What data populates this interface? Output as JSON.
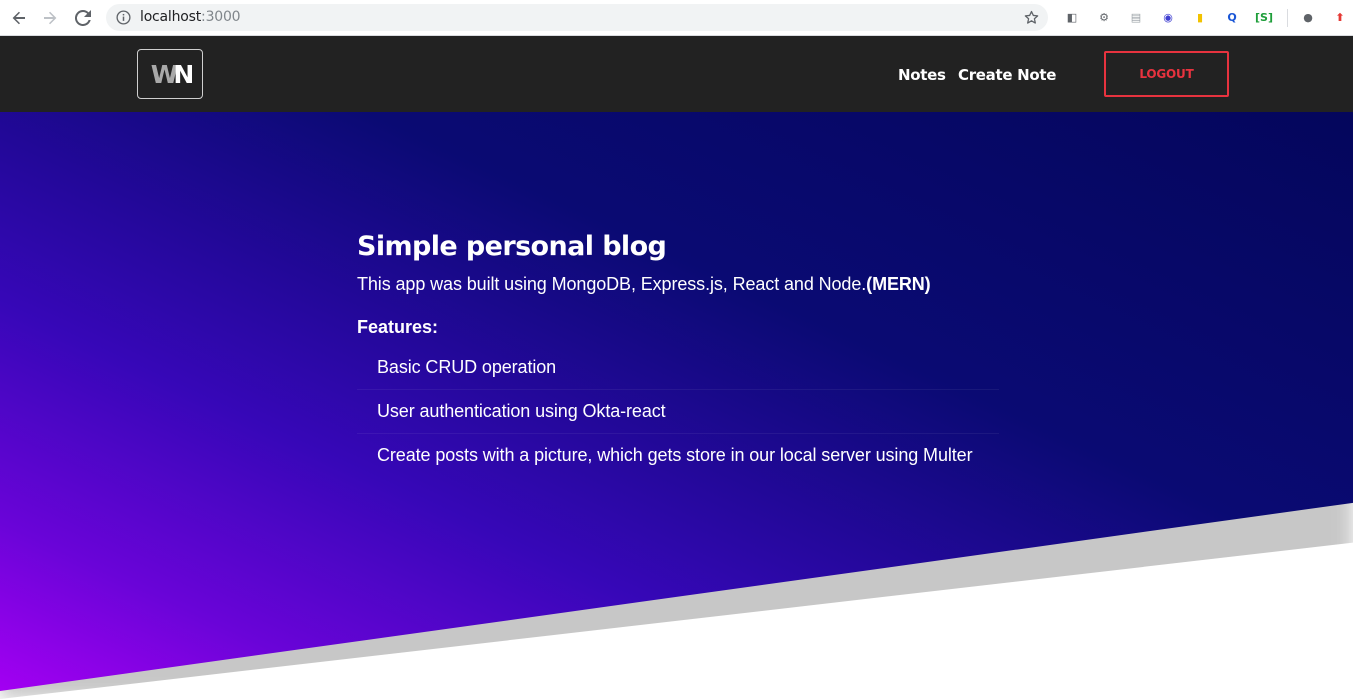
{
  "browser": {
    "url_host": "localhost",
    "url_port": ":3000",
    "extensions": [
      {
        "name": "extension-icon-1",
        "glyph": "◧",
        "color": "#5f6368"
      },
      {
        "name": "extension-icon-2",
        "glyph": "⚙",
        "color": "#5f6368"
      },
      {
        "name": "extension-icon-3",
        "glyph": "▤",
        "color": "#9aa0a6"
      },
      {
        "name": "extension-icon-4",
        "glyph": "◉",
        "color": "#3f3fd1"
      },
      {
        "name": "extension-icon-5",
        "glyph": "▮",
        "color": "#f2c200"
      },
      {
        "name": "extension-icon-6",
        "glyph": "Q",
        "color": "#1a56d6"
      },
      {
        "name": "extension-icon-7",
        "glyph": "[S]",
        "color": "#1e9e3a"
      },
      {
        "name": "extension-icon-8",
        "glyph": "●",
        "color": "#5f6368"
      },
      {
        "name": "extension-icon-9",
        "glyph": "⬆",
        "color": "#e53935"
      }
    ]
  },
  "navbar": {
    "logo_w": "W",
    "logo_n": "N",
    "links": [
      "Notes",
      "Create Note"
    ],
    "logout_label": "LOGOUT",
    "accent_color": "#e8333f"
  },
  "hero": {
    "title": "Simple personal blog",
    "subtitle": "This app was built using MongoDB, Express.js, React and Node.",
    "subtitle_bold": "(MERN)",
    "features_label": "Features:",
    "features": [
      "Basic CRUD operation",
      "User authentication using Okta-react",
      "Create posts with a picture, which gets store in our local server using Multer"
    ]
  }
}
